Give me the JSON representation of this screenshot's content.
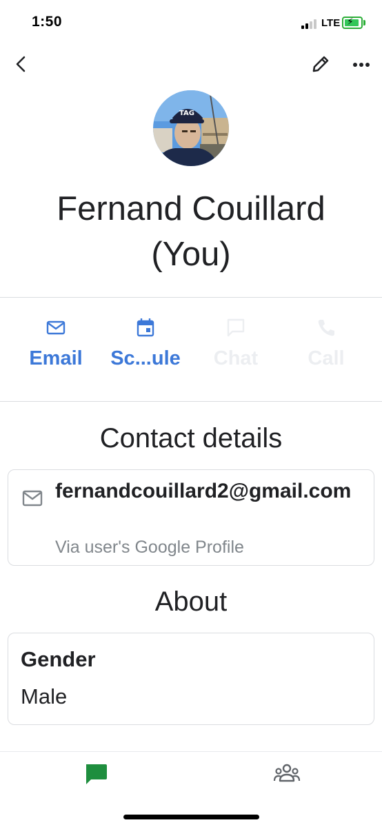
{
  "status_bar": {
    "time": "1:50",
    "network": "LTE"
  },
  "profile": {
    "name_line1": "Fernand Couillard",
    "name_line2": "(You)"
  },
  "actions": [
    {
      "label": "Email",
      "icon": "mail-icon",
      "enabled": true
    },
    {
      "label": "Sc...ule",
      "icon": "calendar-icon",
      "enabled": true
    },
    {
      "label": "Chat",
      "icon": "chat-icon",
      "enabled": false
    },
    {
      "label": "Call",
      "icon": "phone-icon",
      "enabled": false
    }
  ],
  "contact_details": {
    "title": "Contact details",
    "email": "fernandcouillard2@gmail.com",
    "source": "Via user's Google Profile"
  },
  "about": {
    "title": "About",
    "gender_label": "Gender",
    "gender_value": "Male"
  },
  "bottom_nav": {
    "tabs": [
      {
        "icon": "chat-bubble-icon",
        "active": true
      },
      {
        "icon": "people-icon",
        "active": false
      }
    ]
  },
  "colors": {
    "accent": "#3c78d8",
    "active_tab": "#1e8e3e",
    "muted": "#80868b",
    "disabled": "#eceef1"
  }
}
